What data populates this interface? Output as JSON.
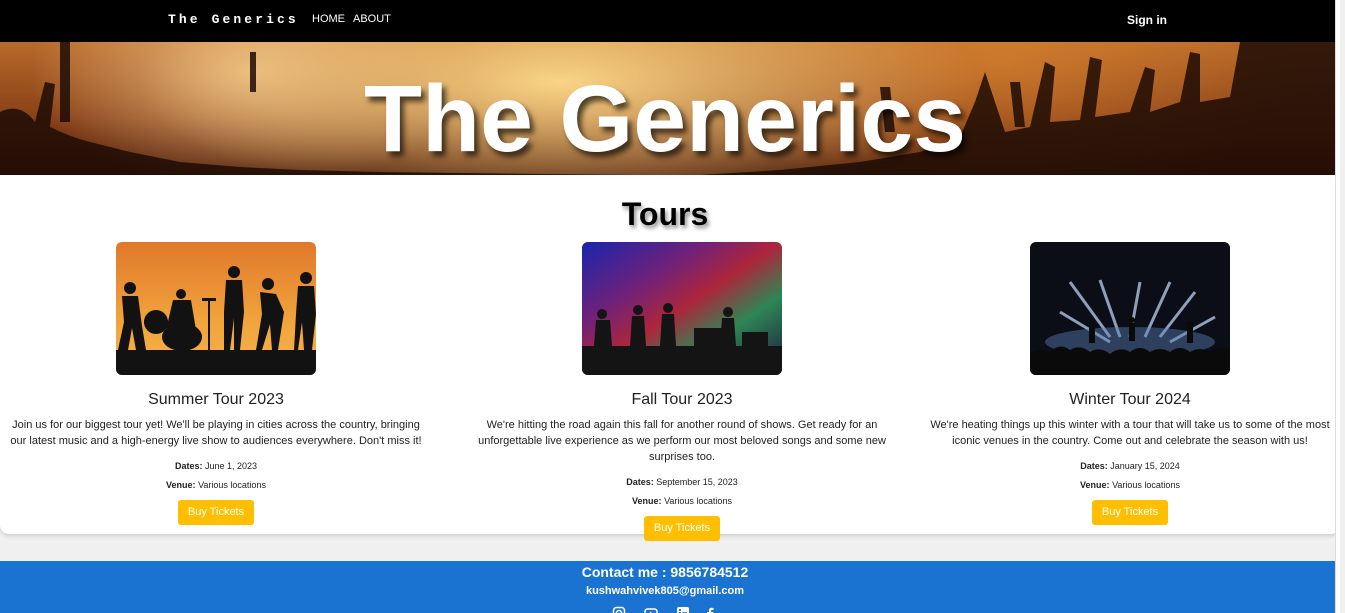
{
  "nav": {
    "brand": "The Generics",
    "links": [
      "HOME",
      "ABOUT"
    ],
    "signin": "Sign in"
  },
  "hero": {
    "title": "The Generics"
  },
  "tours": {
    "heading": "Tours",
    "cards": [
      {
        "title": "Summer Tour 2023",
        "description": "Join us for our biggest tour yet! We'll be playing in cities across the country, bringing our latest music and a high-energy live show to audiences everywhere. Don't miss it!",
        "dates_label": "Dates:",
        "dates": "June 1, 2023",
        "venue_label": "Venue:",
        "venue": "Various locations",
        "button": "Buy Tickets"
      },
      {
        "title": "Fall Tour 2023",
        "description": "We're hitting the road again this fall for another round of shows. Get ready for an unforgettable live experience as we perform our most beloved songs and some new surprises too.",
        "dates_label": "Dates:",
        "dates": "September 15, 2023",
        "venue_label": "Venue:",
        "venue": "Various locations",
        "button": "Buy Tickets"
      },
      {
        "title": "Winter Tour 2024",
        "description": "We're heating things up this winter with a tour that will take us to some of the most iconic venues in the country. Come out and celebrate the season with us!",
        "dates_label": "Dates:",
        "dates": "January 15, 2024",
        "venue_label": "Venue:",
        "venue": "Various locations",
        "button": "Buy Tickets"
      }
    ]
  },
  "footer": {
    "contact": "Contact me : 9856784512",
    "email": "kushwahvivek805@gmail.com",
    "socials": [
      "instagram-icon",
      "youtube-icon",
      "linkedin-icon",
      "facebook-icon"
    ]
  },
  "colors": {
    "navbar": "#000000",
    "button": "#ffbf00",
    "footer": "#1a73d1"
  }
}
